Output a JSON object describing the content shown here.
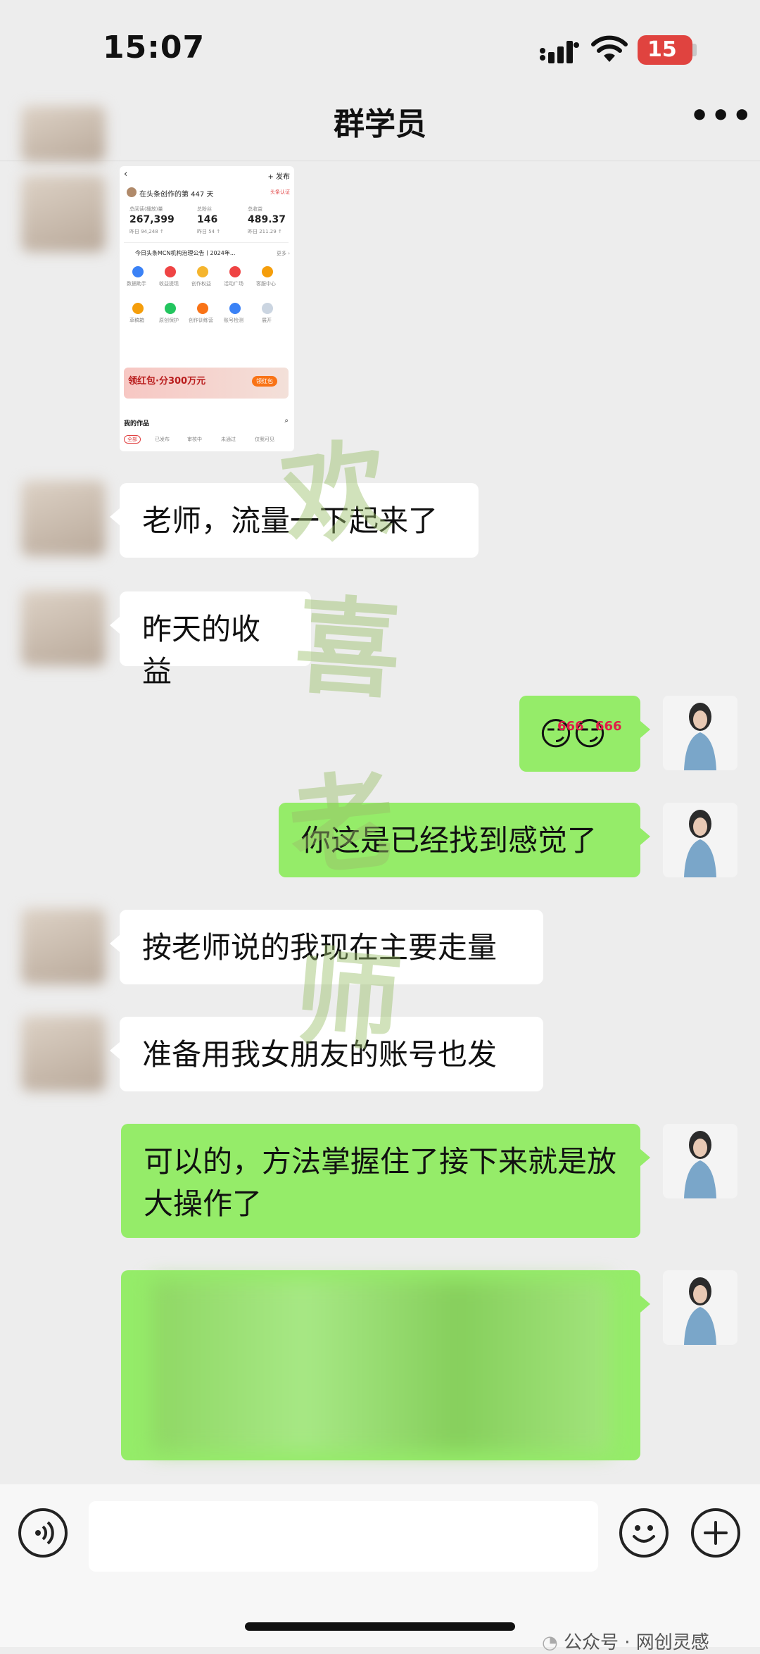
{
  "status_bar": {
    "time": "15:07",
    "battery": "15"
  },
  "nav": {
    "title": "群学员",
    "more": "•••"
  },
  "shared_image": {
    "back": "‹",
    "publish": "+ 发布",
    "days_text": "在头条创作的第 447 天",
    "verify": "头条认证",
    "stats": [
      {
        "label": "总阅读(播放)量",
        "value": "267,399",
        "sub": "昨日 94,248 ↑"
      },
      {
        "label": "总粉丝",
        "value": "146",
        "sub": "昨日 54 ↑"
      },
      {
        "label": "总收益",
        "value": "489.37",
        "sub": "昨日 211.29 ↑"
      }
    ],
    "notice": "今日头条MCN机构治理公告丨2024年...",
    "notice_more": "更多 ›",
    "tools": [
      "数据助手",
      "收益提现",
      "创作权益",
      "活动广场",
      "客服中心",
      "草稿箱",
      "原创保护",
      "创作训练营",
      "账号检测",
      "展开"
    ],
    "banner_title": "领红包·分300万元",
    "banner_btn": "领红包",
    "works_title": "我的作品",
    "works_tabs": [
      "全部",
      "已发布",
      "审核中",
      "未通过",
      "仅我可见"
    ]
  },
  "messages": [
    {
      "side": "left",
      "text": "老师，流量一下起来了"
    },
    {
      "side": "left",
      "text": "昨天的收益"
    },
    {
      "side": "right",
      "text": "😏😏",
      "badge": "666"
    },
    {
      "side": "right",
      "text": "你这是已经找到感觉了"
    },
    {
      "side": "left",
      "text": "按老师说的我现在主要走量"
    },
    {
      "side": "left",
      "text": "准备用我女朋友的账号也发"
    },
    {
      "side": "right",
      "text": "可以的，方法掌握住了接下来就是放大操作了"
    }
  ],
  "watermark": [
    "欢",
    "喜",
    "老",
    "师"
  ],
  "footer": {
    "label": "公众号 · 网创灵感"
  },
  "colors": {
    "bubble_green": "#95ec69",
    "bg": "#ededed",
    "battery": "#e0433f"
  },
  "icons": [
    "signal-icon",
    "wifi-icon",
    "voice-icon",
    "emoji-icon",
    "plus-icon"
  ]
}
